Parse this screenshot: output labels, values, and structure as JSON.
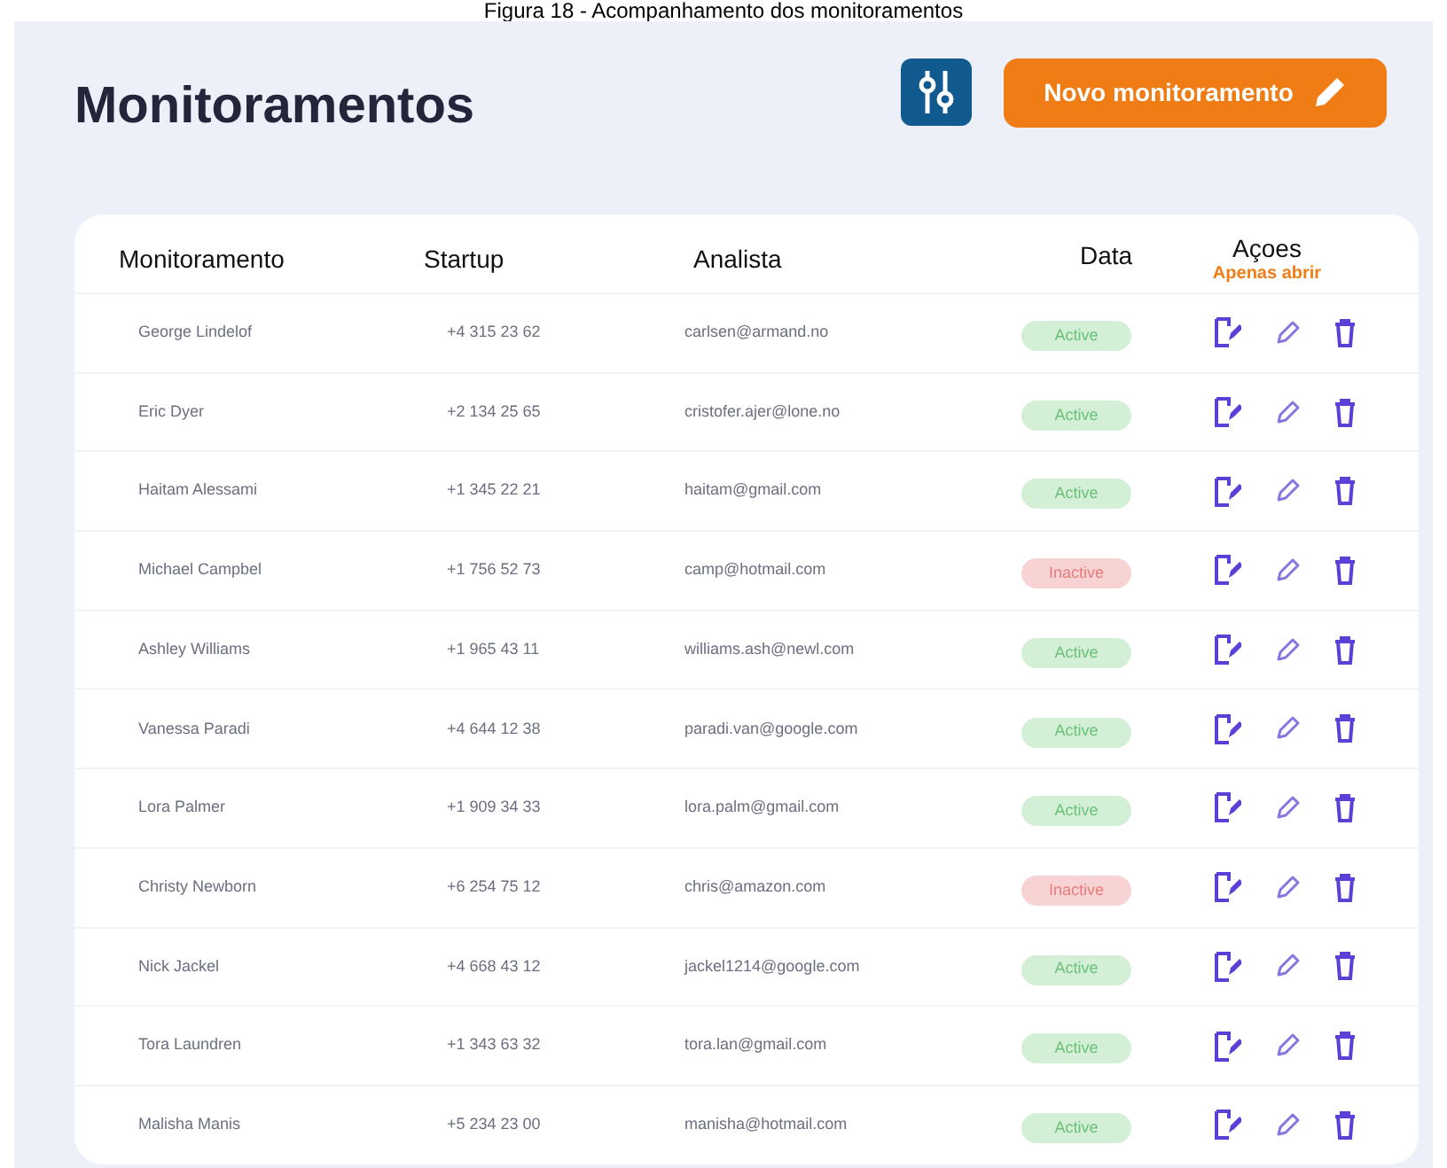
{
  "caption": "Figura 18 - Acompanhamento dos monitoramentos",
  "title": "Monitoramentos",
  "new_button": {
    "label": "Novo monitoramento"
  },
  "table": {
    "columns": [
      "Monitoramento",
      "Startup",
      "Analista",
      "Data",
      "Açoes"
    ],
    "actions_hint": "Apenas abrir",
    "rows": [
      {
        "name": "George Lindelof",
        "phone": "+4 315 23 62",
        "email": "carlsen@armand.no",
        "status": "Active",
        "active": true
      },
      {
        "name": "Eric Dyer",
        "phone": "+2 134 25 65",
        "email": "cristofer.ajer@lone.no",
        "status": "Active",
        "active": true
      },
      {
        "name": "Haitam Alessami",
        "phone": "+1 345 22 21",
        "email": "haitam@gmail.com",
        "status": "Active",
        "active": true
      },
      {
        "name": "Michael Campbel",
        "phone": "+1 756 52 73",
        "email": "camp@hotmail.com",
        "status": "Inactive",
        "active": false
      },
      {
        "name": "Ashley Williams",
        "phone": "+1 965 43 11",
        "email": "williams.ash@newl.com",
        "status": "Active",
        "active": true
      },
      {
        "name": "Vanessa Paradi",
        "phone": "+4 644 12 38",
        "email": "paradi.van@google.com",
        "status": "Active",
        "active": true
      },
      {
        "name": "Lora Palmer",
        "phone": "+1 909 34 33",
        "email": "lora.palm@gmail.com",
        "status": "Active",
        "active": true
      },
      {
        "name": "Christy Newborn",
        "phone": "+6 254 75 12",
        "email": "chris@amazon.com",
        "status": "Inactive",
        "active": false
      },
      {
        "name": "Nick Jackel",
        "phone": "+4 668 43 12",
        "email": "jackel1214@google.com",
        "status": "Active",
        "active": true
      },
      {
        "name": "Tora Laundren",
        "phone": "+1 343 63 32",
        "email": "tora.lan@gmail.com",
        "status": "Active",
        "active": true
      },
      {
        "name": "Malisha Manis",
        "phone": "+5 234 23 00",
        "email": "manisha@hotmail.com",
        "status": "Active",
        "active": true
      }
    ]
  }
}
